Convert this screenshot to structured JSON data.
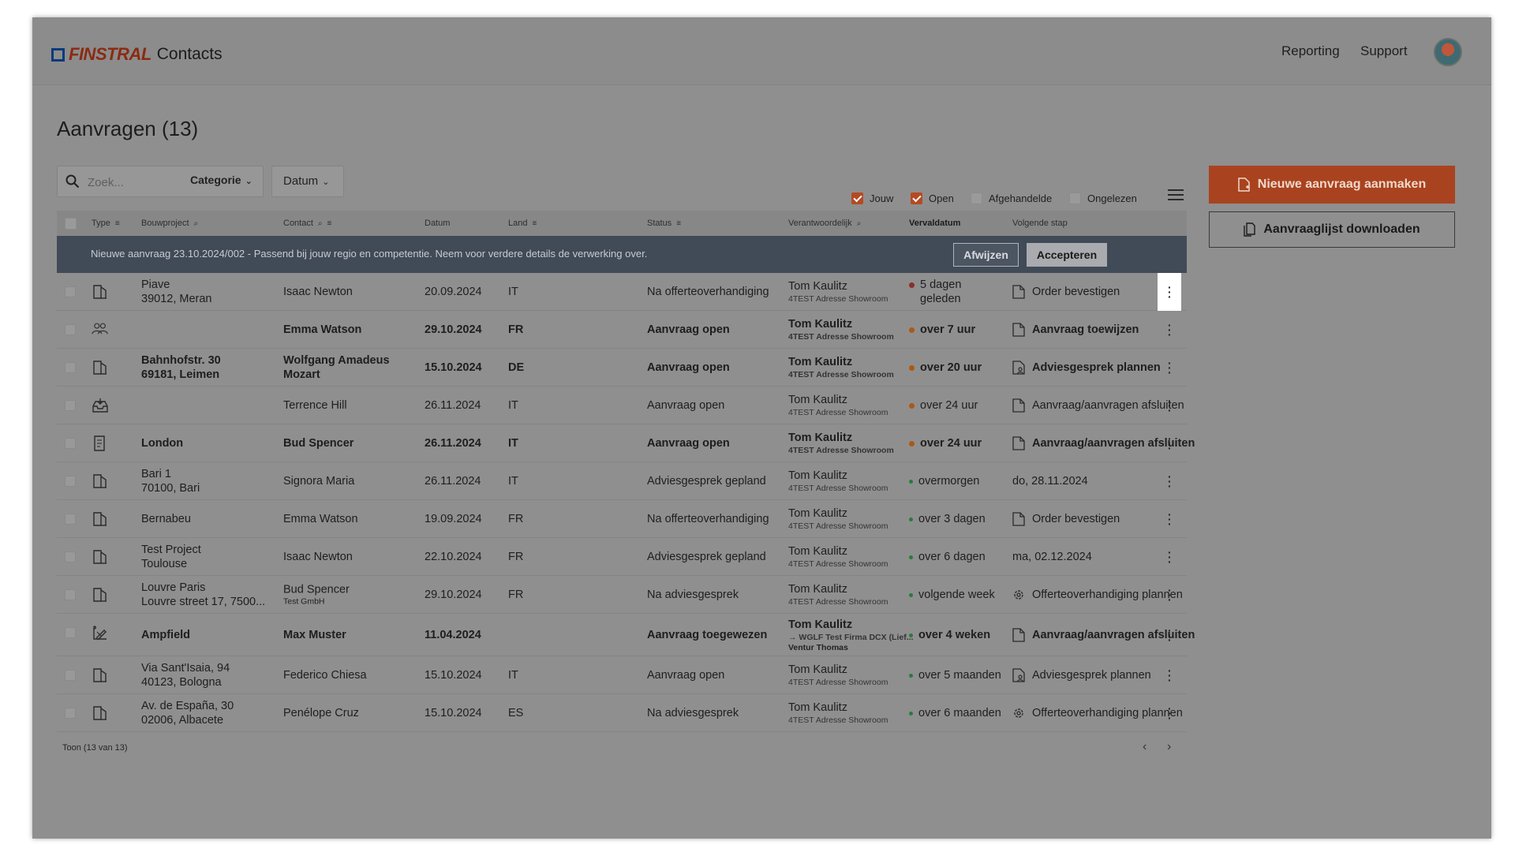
{
  "header": {
    "logo_text": "FINSTRAL",
    "app_name": "Contacts",
    "nav": {
      "reporting": "Reporting",
      "support": "Support"
    }
  },
  "page": {
    "title": "Aanvragen (13)"
  },
  "toolbar": {
    "search_placeholder": "Zoek...",
    "categorie_label": "Categorie",
    "datum_label": "Datum",
    "filters": {
      "jouw": {
        "label": "Jouw",
        "checked": true
      },
      "open": {
        "label": "Open",
        "checked": true
      },
      "afgehandelde": {
        "label": "Afgehandelde",
        "checked": false
      },
      "ongelezen": {
        "label": "Ongelezen",
        "checked": false
      }
    },
    "menu_icon": "hamburger-icon"
  },
  "actions": {
    "new_request": "Nieuwe aanvraag aanmaken",
    "download_list": "Aanvraaglijst downloaden"
  },
  "colors": {
    "accent": "#a9431f",
    "banner": "#414a57",
    "overlay": "#8f8f8f"
  },
  "table": {
    "columns": {
      "type": "Type",
      "bouwproject": "Bouwproject",
      "contact": "Contact",
      "datum": "Datum",
      "land": "Land",
      "status": "Status",
      "verantwoordelijk": "Verantwoordelijk",
      "vervaldatum": "Vervaldatum",
      "volgende_stap": "Volgende stap"
    },
    "banner": {
      "text": "Nieuwe aanvraag 23.10.2024/002 - Passend bij jouw regio en competentie. Neem voor verdere details de verwerking over.",
      "reject": "Afwijzen",
      "accept": "Accepteren"
    },
    "rows": [
      {
        "type_icon": "window-door-icon",
        "project1": "Piave",
        "project2": "39012, Meran",
        "contact": "Isaac Newton",
        "contact_sub": "",
        "date": "20.09.2024",
        "land": "IT",
        "status": "Na offerteoverhandiging",
        "resp": "Tom Kaulitz",
        "resp_sub": "4TEST Adresse Showroom",
        "resp_sub2": "",
        "due": "5 dagen geleden",
        "due_color": "red",
        "next": "Order bevestigen",
        "next_icon": "document-icon",
        "bold": false
      },
      {
        "type_icon": "people-icon",
        "project1": "",
        "project2": "",
        "contact": "Emma Watson",
        "contact_sub": "",
        "date": "29.10.2024",
        "land": "FR",
        "status": "Aanvraag open",
        "resp": "Tom Kaulitz",
        "resp_sub": "4TEST Adresse Showroom",
        "resp_sub2": "",
        "due": "over 7 uur",
        "due_color": "orange",
        "next": "Aanvraag toewijzen",
        "next_icon": "document-icon",
        "bold": true
      },
      {
        "type_icon": "window-door-icon",
        "project1": "Bahnhofstr. 30",
        "project2": "69181, Leimen",
        "contact": "Wolfgang Amadeus Mozart",
        "contact_sub": "",
        "date": "15.10.2024",
        "land": "DE",
        "status": "Aanvraag open",
        "resp": "Tom Kaulitz",
        "resp_sub": "4TEST Adresse Showroom",
        "resp_sub2": "",
        "due": "over 20 uur",
        "due_color": "orange",
        "next": "Adviesgesprek plannen",
        "next_icon": "document-person-icon",
        "bold": true
      },
      {
        "type_icon": "inbox-icon",
        "project1": "",
        "project2": "",
        "contact": "Terrence Hill",
        "contact_sub": "",
        "date": "26.11.2024",
        "land": "IT",
        "status": "Aanvraag open",
        "resp": "Tom Kaulitz",
        "resp_sub": "4TEST Adresse Showroom",
        "resp_sub2": "",
        "due": "over 24 uur",
        "due_color": "orange",
        "next": "Aanvraag/aanvragen afsluiten",
        "next_icon": "document-icon",
        "bold": false
      },
      {
        "type_icon": "form-icon",
        "project1": "London",
        "project2": "",
        "contact": "Bud Spencer",
        "contact_sub": "",
        "date": "26.11.2024",
        "land": "IT",
        "status": "Aanvraag open",
        "resp": "Tom Kaulitz",
        "resp_sub": "4TEST Adresse Showroom",
        "resp_sub2": "",
        "due": "over 24 uur",
        "due_color": "orange",
        "next": "Aanvraag/aanvragen afsluiten",
        "next_icon": "document-icon",
        "bold": true
      },
      {
        "type_icon": "window-door-icon",
        "project1": "Bari 1",
        "project2": "70100, Bari",
        "contact": "Signora Maria",
        "contact_sub": "",
        "date": "26.11.2024",
        "land": "IT",
        "status": "Adviesgesprek gepland",
        "resp": "Tom Kaulitz",
        "resp_sub": "4TEST Adresse Showroom",
        "resp_sub2": "",
        "due": "overmorgen",
        "due_color": "green",
        "next": "do, 28.11.2024",
        "next_icon": "",
        "bold": false
      },
      {
        "type_icon": "window-door-icon",
        "project1": "Bernabeu",
        "project2": "",
        "contact": "Emma Watson",
        "contact_sub": "",
        "date": "19.09.2024",
        "land": "FR",
        "status": "Na offerteoverhandiging",
        "resp": "Tom Kaulitz",
        "resp_sub": "4TEST Adresse Showroom",
        "resp_sub2": "",
        "due": "over 3 dagen",
        "due_color": "green",
        "next": "Order bevestigen",
        "next_icon": "document-icon",
        "bold": false
      },
      {
        "type_icon": "window-door-icon",
        "project1": "Test Project",
        "project2": "Toulouse",
        "contact": "Isaac Newton",
        "contact_sub": "",
        "date": "22.10.2024",
        "land": "FR",
        "status": "Adviesgesprek gepland",
        "resp": "Tom Kaulitz",
        "resp_sub": "4TEST Adresse Showroom",
        "resp_sub2": "",
        "due": "over 6 dagen",
        "due_color": "green",
        "next": "ma, 02.12.2024",
        "next_icon": "",
        "bold": false
      },
      {
        "type_icon": "window-door-icon",
        "project1": "Louvre Paris",
        "project2": "Louvre street 17, 7500...",
        "contact": "Bud Spencer",
        "contact_sub": "Test GmbH",
        "date": "29.10.2024",
        "land": "FR",
        "status": "Na adviesgesprek",
        "resp": "Tom Kaulitz",
        "resp_sub": "4TEST Adresse Showroom",
        "resp_sub2": "",
        "due": "volgende week",
        "due_color": "green",
        "next": "Offerteoverhandiging plannen",
        "next_icon": "gear-icon",
        "bold": false
      },
      {
        "type_icon": "blueprint-icon",
        "project1": "Ampfield",
        "project2": "",
        "contact": "Max Muster",
        "contact_sub": "",
        "date": "11.04.2024",
        "land": "",
        "status": "Aanvraag toegewezen",
        "resp": "Tom Kaulitz",
        "resp_sub": "→ WGLF Test Firma DCX (Lief...",
        "resp_sub2": "Ventur Thomas",
        "due": "over 4 weken",
        "due_color": "green",
        "next": "Aanvraag/aanvragen afsluiten",
        "next_icon": "document-icon",
        "bold": true
      },
      {
        "type_icon": "window-door-icon",
        "project1": "Via Sant'Isaia, 94",
        "project2": "40123, Bologna",
        "contact": "Federico Chiesa",
        "contact_sub": "",
        "date": "15.10.2024",
        "land": "IT",
        "status": "Aanvraag open",
        "resp": "Tom Kaulitz",
        "resp_sub": "4TEST Adresse Showroom",
        "resp_sub2": "",
        "due": "over 5 maanden",
        "due_color": "green",
        "next": "Adviesgesprek plannen",
        "next_icon": "document-person-icon",
        "bold": false
      },
      {
        "type_icon": "window-door-icon",
        "project1": "Av. de España, 30",
        "project2": "02006, Albacete",
        "contact": "Penélope Cruz",
        "contact_sub": "",
        "date": "15.10.2024",
        "land": "ES",
        "status": "Na adviesgesprek",
        "resp": "Tom Kaulitz",
        "resp_sub": "4TEST Adresse Showroom",
        "resp_sub2": "",
        "due": "over 6 maanden",
        "due_color": "green",
        "next": "Offerteoverhandiging plannen",
        "next_icon": "gear-icon",
        "bold": false
      }
    ],
    "footer": {
      "toon": "Toon  (13 van 13)"
    }
  }
}
